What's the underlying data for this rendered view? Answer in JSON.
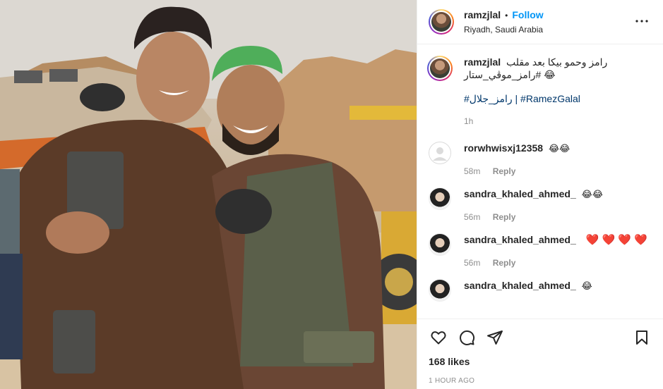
{
  "post": {
    "username": "ramzjlal",
    "separator": "•",
    "follow_label": "Follow",
    "location": "Riyadh, Saudi Arabia",
    "more_icon": "more-horizontal-icon"
  },
  "caption": {
    "username": "ramzjlal",
    "text": "رامز وحمو بيكا بعد مقلب #رامز_موڤي_ستار 😂",
    "hashtags": "#رامز_جلال | #RamezGalal",
    "time": "1h"
  },
  "comments": [
    {
      "username": "rorwhwisxj12358",
      "text": "😂😂",
      "time": "58m",
      "reply": "Reply"
    },
    {
      "username": "sandra_khaled_ahmed_",
      "text": "😂😂",
      "time": "56m",
      "reply": "Reply"
    },
    {
      "username": "sandra_khaled_ahmed_",
      "text": "❤️ ❤️ ❤️ ❤️",
      "time": "56m",
      "reply": "Reply"
    },
    {
      "username": "sandra_khaled_ahmed_",
      "text": "😂",
      "time": "",
      "reply": ""
    }
  ],
  "engagement": {
    "likes": "168 likes",
    "posted": "1 HOUR AGO"
  },
  "colors": {
    "link": "#0095f6",
    "hashtag": "#00376b",
    "muted": "#8e8e8e",
    "heart": "#ed2b3a"
  }
}
